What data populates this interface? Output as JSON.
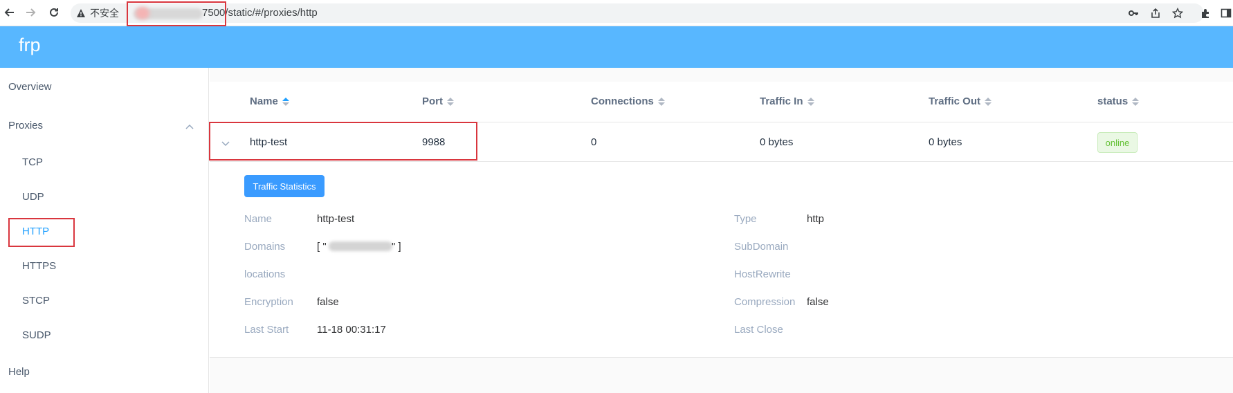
{
  "browser": {
    "security_label": "不安全",
    "url_visible": "7500/static/#/proxies/http"
  },
  "app": {
    "brand": "frp"
  },
  "sidebar": {
    "overview": "Overview",
    "proxies": "Proxies",
    "sub_items": [
      "TCP",
      "UDP",
      "HTTP",
      "HTTPS",
      "STCP",
      "SUDP"
    ],
    "active": "HTTP",
    "help": "Help"
  },
  "table": {
    "columns": [
      "Name",
      "Port",
      "Connections",
      "Traffic In",
      "Traffic Out",
      "status"
    ],
    "rows": [
      {
        "name": "http-test",
        "port": "9988",
        "connections": "0",
        "traffic_in": "0 bytes",
        "traffic_out": "0 bytes",
        "status": "online"
      }
    ]
  },
  "details": {
    "button": "Traffic Statistics",
    "left": [
      {
        "label": "Name",
        "value": "http-test"
      },
      {
        "label": "Domains",
        "value_prefix": "[ \"",
        "value_suffix": "\" ]"
      },
      {
        "label": "locations",
        "value": ""
      },
      {
        "label": "Encryption",
        "value": "false"
      },
      {
        "label": "Last Start",
        "value": "11-18 00:31:17"
      }
    ],
    "right": [
      {
        "label": "Type",
        "value": "http"
      },
      {
        "label": "SubDomain",
        "value": ""
      },
      {
        "label": "HostRewrite",
        "value": ""
      },
      {
        "label": "Compression",
        "value": "false"
      },
      {
        "label": "Last Close",
        "value": ""
      }
    ]
  },
  "colors": {
    "header": "#58b7ff",
    "accent": "#20a0ff",
    "highlight_box": "#d9363e",
    "online": "#67c23a"
  }
}
